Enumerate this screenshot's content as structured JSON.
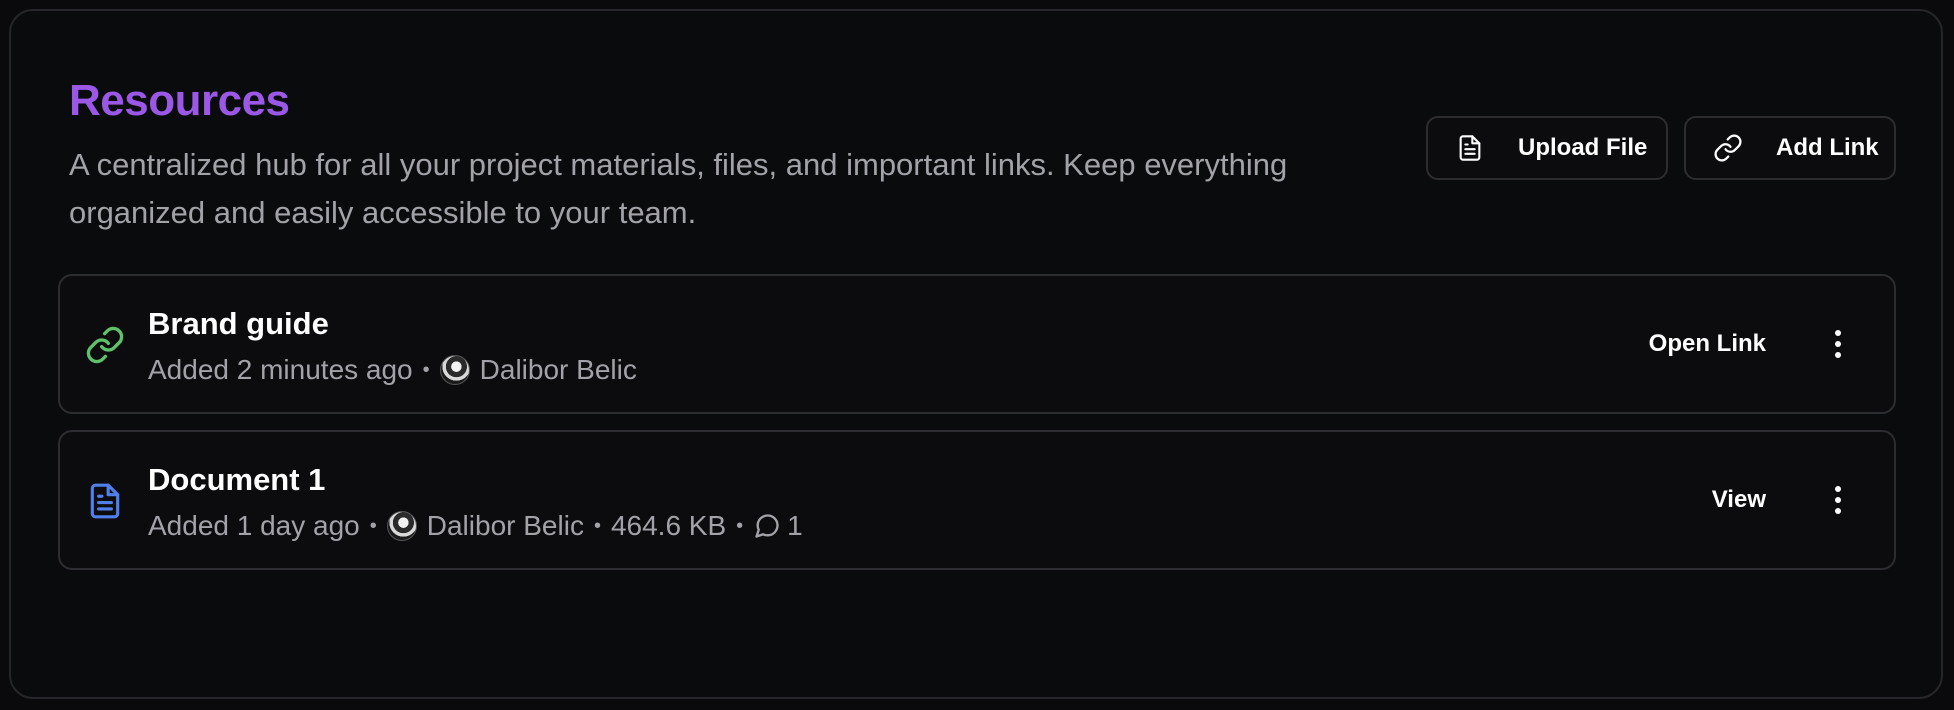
{
  "header": {
    "title": "Resources",
    "description": "A centralized hub for all your project materials, files, and important links. Keep everything organized and easily accessible to your team."
  },
  "toolbar": {
    "upload_label": "Upload File",
    "upload_icon": "file-icon",
    "add_link_label": "Add Link",
    "add_link_icon": "link-icon"
  },
  "resources": [
    {
      "name": "Brand guide",
      "type_icon": "link-icon",
      "icon_color": "#5fc26a",
      "added": "Added 2 minutes ago",
      "author": "Dalibor Belic",
      "action_label": "Open Link"
    },
    {
      "name": "Document 1",
      "type_icon": "document-icon",
      "icon_color": "#4f7fea",
      "added": "Added 1 day ago",
      "author": "Dalibor Belic",
      "size": "464.6 KB",
      "comments": "1",
      "action_label": "View"
    }
  ],
  "separator": "•",
  "colors": {
    "accent": "#9b57e6",
    "background": "#0a0b0d",
    "border": "#2c2c31",
    "muted_text": "#a2a2a8"
  }
}
